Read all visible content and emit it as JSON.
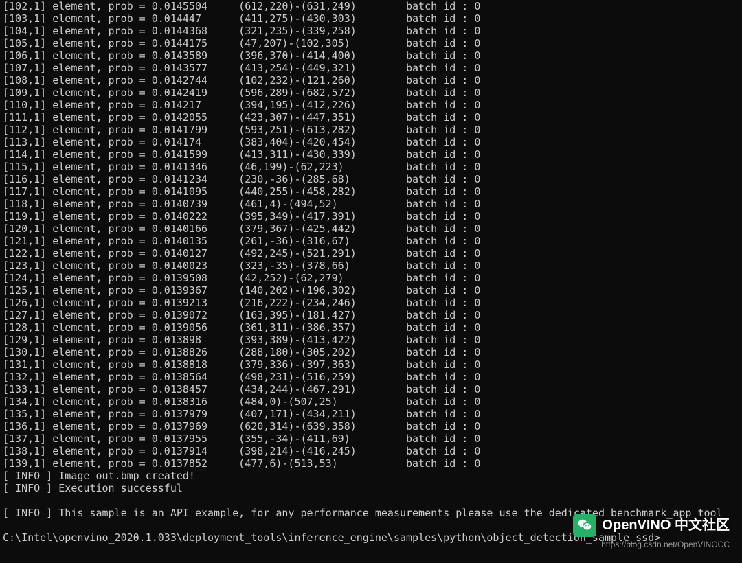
{
  "batch_suffix": "batch id : 0",
  "rows": [
    {
      "idx": 102,
      "prob": "0.0145504",
      "box": "(612,220)-(631,249)"
    },
    {
      "idx": 103,
      "prob": "0.014447",
      "box": "(411,275)-(430,303)"
    },
    {
      "idx": 104,
      "prob": "0.0144368",
      "box": "(321,235)-(339,258)"
    },
    {
      "idx": 105,
      "prob": "0.0144175",
      "box": "(47,207)-(102,305)"
    },
    {
      "idx": 106,
      "prob": "0.0143589",
      "box": "(396,370)-(414,400)"
    },
    {
      "idx": 107,
      "prob": "0.0143577",
      "box": "(413,254)-(449,321)"
    },
    {
      "idx": 108,
      "prob": "0.0142744",
      "box": "(102,232)-(121,260)"
    },
    {
      "idx": 109,
      "prob": "0.0142419",
      "box": "(596,289)-(682,572)"
    },
    {
      "idx": 110,
      "prob": "0.014217",
      "box": "(394,195)-(412,226)"
    },
    {
      "idx": 111,
      "prob": "0.0142055",
      "box": "(423,307)-(447,351)"
    },
    {
      "idx": 112,
      "prob": "0.0141799",
      "box": "(593,251)-(613,282)"
    },
    {
      "idx": 113,
      "prob": "0.014174",
      "box": "(383,404)-(420,454)"
    },
    {
      "idx": 114,
      "prob": "0.0141599",
      "box": "(413,311)-(430,339)"
    },
    {
      "idx": 115,
      "prob": "0.0141346",
      "box": "(46,199)-(62,223)"
    },
    {
      "idx": 116,
      "prob": "0.0141234",
      "box": "(230,-36)-(285,68)"
    },
    {
      "idx": 117,
      "prob": "0.0141095",
      "box": "(440,255)-(458,282)"
    },
    {
      "idx": 118,
      "prob": "0.0140739",
      "box": "(461,4)-(494,52)"
    },
    {
      "idx": 119,
      "prob": "0.0140222",
      "box": "(395,349)-(417,391)"
    },
    {
      "idx": 120,
      "prob": "0.0140166",
      "box": "(379,367)-(425,442)"
    },
    {
      "idx": 121,
      "prob": "0.0140135",
      "box": "(261,-36)-(316,67)"
    },
    {
      "idx": 122,
      "prob": "0.0140127",
      "box": "(492,245)-(521,291)"
    },
    {
      "idx": 123,
      "prob": "0.0140023",
      "box": "(323,-35)-(378,66)"
    },
    {
      "idx": 124,
      "prob": "0.0139508",
      "box": "(42,252)-(62,279)"
    },
    {
      "idx": 125,
      "prob": "0.0139367",
      "box": "(140,202)-(196,302)"
    },
    {
      "idx": 126,
      "prob": "0.0139213",
      "box": "(216,222)-(234,246)"
    },
    {
      "idx": 127,
      "prob": "0.0139072",
      "box": "(163,395)-(181,427)"
    },
    {
      "idx": 128,
      "prob": "0.0139056",
      "box": "(361,311)-(386,357)"
    },
    {
      "idx": 129,
      "prob": "0.013898",
      "box": "(393,389)-(413,422)"
    },
    {
      "idx": 130,
      "prob": "0.0138826",
      "box": "(288,180)-(305,202)"
    },
    {
      "idx": 131,
      "prob": "0.0138818",
      "box": "(379,336)-(397,363)"
    },
    {
      "idx": 132,
      "prob": "0.0138564",
      "box": "(498,231)-(516,259)"
    },
    {
      "idx": 133,
      "prob": "0.0138457",
      "box": "(434,244)-(467,291)"
    },
    {
      "idx": 134,
      "prob": "0.0138316",
      "box": "(484,0)-(507,25)"
    },
    {
      "idx": 135,
      "prob": "0.0137979",
      "box": "(407,171)-(434,211)"
    },
    {
      "idx": 136,
      "prob": "0.0137969",
      "box": "(620,314)-(639,358)"
    },
    {
      "idx": 137,
      "prob": "0.0137955",
      "box": "(355,-34)-(411,69)"
    },
    {
      "idx": 138,
      "prob": "0.0137914",
      "box": "(398,214)-(416,245)"
    },
    {
      "idx": 139,
      "prob": "0.0137852",
      "box": "(477,6)-(513,53)"
    }
  ],
  "info": {
    "created": "[ INFO ] Image out.bmp created!",
    "success": "[ INFO ] Execution successful",
    "api_note": "[ INFO ] This sample is an API example, for any performance measurements please use the dedicated benchmark_app tool"
  },
  "prompt": "C:\\Intel\\openvino_2020.1.033\\deployment_tools\\inference_engine\\samples\\python\\object_detection_sample_ssd>",
  "watermark": {
    "main": "OpenVINO 中文社区",
    "sub": "https://blog.csdn.net/OpenVINOCC"
  }
}
